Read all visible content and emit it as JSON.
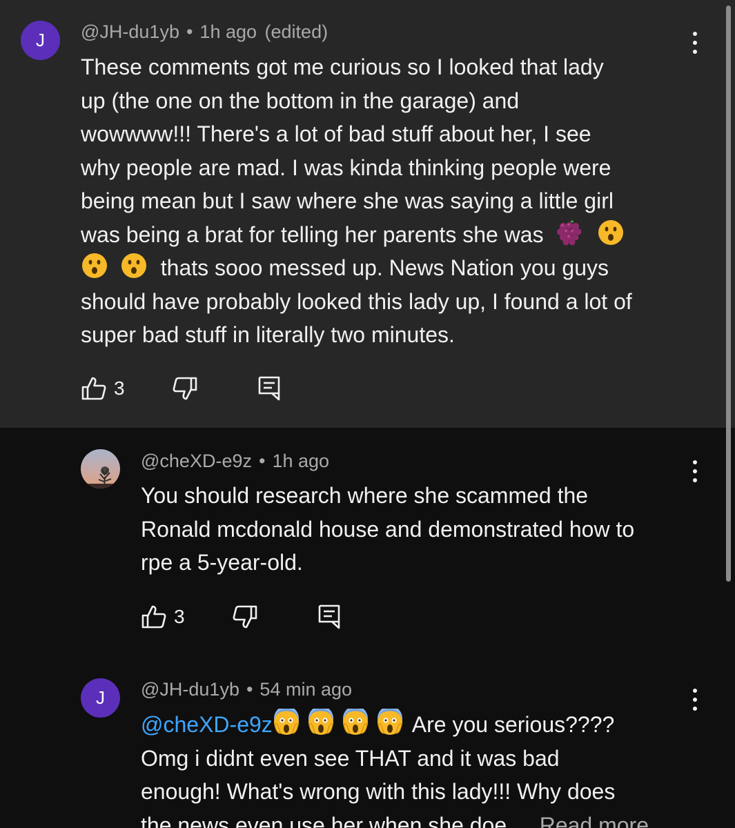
{
  "comment1": {
    "avatar_letter": "J",
    "username": "@JH-du1yb",
    "time": "1h ago",
    "edited": "(edited)",
    "lines": [
      "These comments got me curious so I looked that lady",
      "up (the one on the bottom in the garage) and",
      "wowwww!!! There's a lot of bad stuff about her, I see",
      "why people are mad. I was kinda thinking people were",
      "being mean but I saw where she was saying a little girl",
      "was being a brat for telling her parents she was",
      "thats sooo messed up. News Nation you guys",
      "should have probably looked this lady up, I found a lot of",
      "super bad stuff in literally two minutes."
    ],
    "likes": "3"
  },
  "reply1": {
    "username": "@cheXD-e9z",
    "time": "1h ago",
    "lines": [
      "You should research where she scammed the",
      "Ronald mcdonald house and demonstrated how to",
      "rpe a 5-year-old."
    ],
    "likes": "3"
  },
  "reply2": {
    "avatar_letter": "J",
    "username": "@JH-du1yb",
    "time": "54 min ago",
    "mention": "@cheXD-e9z",
    "line1_rest": "Are you serious????",
    "lines": [
      "Omg i didnt even see THAT and it was bad",
      "enough! What's wrong with this lady!!! Why does",
      "the news even use her when she doe..."
    ],
    "read_more": "Read more"
  },
  "icons": {
    "like": "thumbs-up-icon",
    "dislike": "thumbs-down-icon",
    "reply": "reply-comment-icon",
    "more": "more-vertical-icon",
    "grapes": "grapes-emoji",
    "hushed": "hushed-face-emoji",
    "scream": "screaming-face-emoji"
  },
  "colors": {
    "main_bg": "#272727",
    "page_bg": "#0f0f0f",
    "avatar_purple": "#5b2fb9",
    "mention_blue": "#3ea6ff",
    "meta_gray": "#aaaaaa"
  }
}
